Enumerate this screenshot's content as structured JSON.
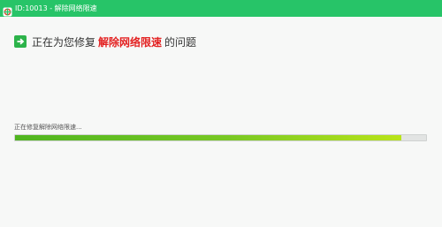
{
  "window": {
    "title": "ID:10013 - 解除网络限速"
  },
  "headline": {
    "prefix": "正在为您修复",
    "highlight": "解除网络限速",
    "suffix": "的问题"
  },
  "progress": {
    "status_text": "正在修复解除网络限速...",
    "value_percent": 94
  },
  "colors": {
    "titlebar": "#27c468",
    "highlight": "#e32222",
    "progress_start": "#4fb51f",
    "progress_end": "#b9e419"
  }
}
